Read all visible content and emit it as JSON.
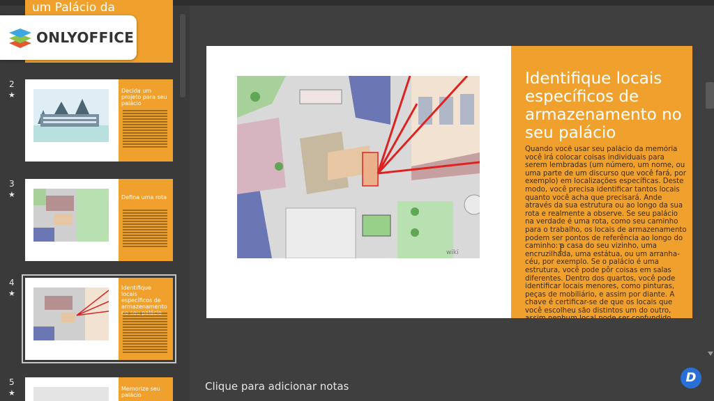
{
  "app": {
    "brand": "ONLYOFFICE"
  },
  "thumbnails": [
    {
      "number": "",
      "title": "um Palácio da"
    },
    {
      "number": "2",
      "title": "Decida um projeto para seu palácio"
    },
    {
      "number": "3",
      "title": "Defina uma rota"
    },
    {
      "number": "4",
      "title": "Identifique locais específicos de armazenamento no seu palácio"
    },
    {
      "number": "5",
      "title": "Memorize seu palácio"
    }
  ],
  "slide": {
    "title": "Identifique locais específicos de armazenamento no seu palácio",
    "body": "Quando você usar seu palácio da memória você irá colocar coisas individuais para serem lembradas (um número, um nome, ou uma parte de um discurso que você fará, por exemplo) em localizações específicas. Deste modo, você precisa identificar tantos locais quanto você acha que precisará. Ande através da sua estrutura ou ao longo da sua rota e realmente a observe. Se seu palácio na verdade é uma rota, como seu caminho para o trabalho, os locais de armazenamento podem ser pontos de referência ao longo do caminho: a casa do seu vizinho, uma encruzilhada, uma estátua, ou um arranha-céu, por exemplo. Se o palácio é uma estrutura, você pode pôr coisas em salas diferentes. Dentro dos quartos, você pode identificar locais menores, como pinturas, peças de mobiliário, e assim por diante. A chave é certificar-se de que os locais que você escolheu são distintos um do outro, assim nenhum local pode ser confundido com outro.",
    "watermark": "wiki"
  },
  "notes": {
    "placeholder": "Clique para adicionar notas"
  },
  "badge": {
    "letter": "D"
  }
}
